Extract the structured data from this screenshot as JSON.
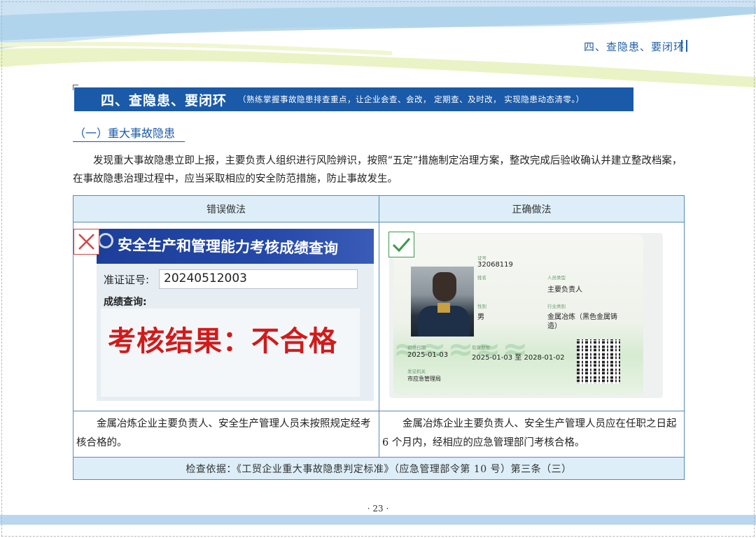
{
  "header": {
    "running_title": "四、查隐患、要闭环"
  },
  "banner": {
    "title": "四、查隐患、要闭环",
    "subtitle": "（熟练掌握事故隐患排查重点，让企业会查、会改， 定期查、及时改， 实现隐患动态清零。）"
  },
  "section": {
    "title": "（一）重大事故隐患"
  },
  "body": {
    "paragraph": "发现重大事故隐患立即上报，主要负责人组织进行风险辨识，按照“五定”措施制定治理方案，整改完成后验收确认并建立整改档案，在事故隐患治理过程中，应当采取相应的安全防范措施，防止事故发生。"
  },
  "table": {
    "col_wrong": "错误做法",
    "col_right": "正确做法",
    "wrong_desc": "金属冶炼企业主要负责人、安全生产管理人员未按照规定经考核合格的。",
    "right_desc": "金属冶炼企业主要负责人、安全生产管理人员应在任职之日起 6 个月内，经相应的应急管理部门考核合格。",
    "basis": "检查依据：《工贸企业重大事故隐患判定标准》（应急管理部令第 10 号）第三条（三）"
  },
  "wrong_photo": {
    "title": "安全生产和管理能力考核成绩查询",
    "id_label": "准证证号:",
    "id_value": "20240512003",
    "query_label": "成绩查询:",
    "result": "考核结果：不合格"
  },
  "right_photo": {
    "f_id_label": "证号",
    "f_id_value": "32068119",
    "f_name_label": "姓名",
    "f_type_label": "人员类型",
    "f_type_value": "主要负责人",
    "f_sex_label": "性别",
    "f_sex_value": "男",
    "f_industry_label": "行业类别",
    "f_industry_value": "金属冶炼（黑色金属铸",
    "f_industry_value2": "造）",
    "f_issue_label": "初领日期",
    "f_issue_value": "2025-01-03",
    "f_valid_label": "有效期限",
    "f_valid_value": "2025-01-03 至 2028-01-02",
    "f_authority_label": "发证机关",
    "f_authority_value": "市应急管理局"
  },
  "footer": {
    "page_number": "· 23 ·"
  },
  "colors": {
    "brand_blue": "#1a5aa8",
    "table_header": "#ddeef8",
    "wrong_red": "#d04848",
    "right_green": "#3a9a48",
    "result_red": "#d21a1a"
  },
  "icons": {
    "wrong": "cross-mark-icon",
    "right": "check-mark-icon",
    "header_bars": "double-bar-icon"
  }
}
